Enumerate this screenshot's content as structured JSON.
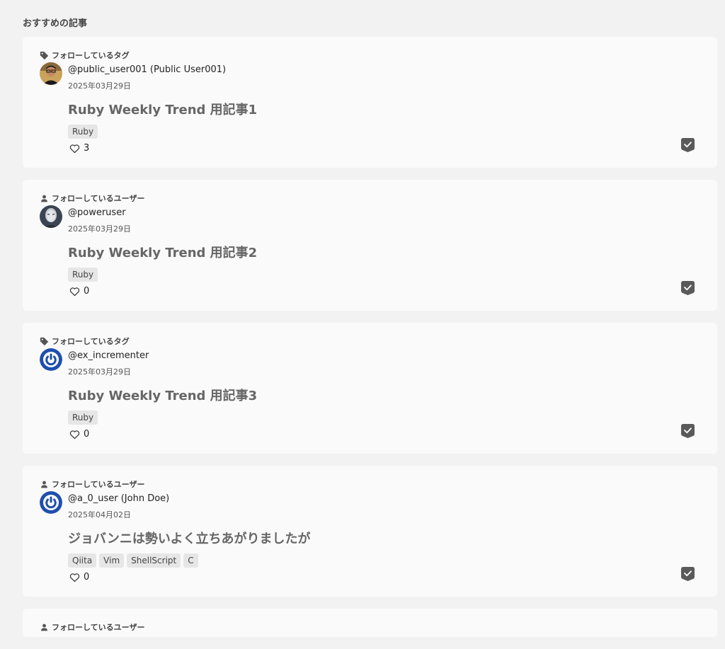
{
  "page": {
    "section_title": "おすすめの記事"
  },
  "articles": [
    {
      "reason": "フォローしているタグ",
      "reason_icon": "tag-icon",
      "author": "@public_user001 (Public User001)",
      "avatar": "avatar-photo-man",
      "date": "2025年03月29日",
      "title": "Ruby Weekly Trend 用記事1",
      "tags": [
        "Ruby"
      ],
      "likes": "3"
    },
    {
      "reason": "フォローしているユーザー",
      "reason_icon": "user-icon",
      "author": "@poweruser",
      "avatar": "avatar-photo-face",
      "date": "2025年03月29日",
      "title": "Ruby Weekly Trend 用記事2",
      "tags": [
        "Ruby"
      ],
      "likes": "0"
    },
    {
      "reason": "フォローしているタグ",
      "reason_icon": "tag-icon",
      "author": "@ex_incrementer",
      "avatar": "avatar-power-logo",
      "date": "2025年03月29日",
      "title": "Ruby Weekly Trend 用記事3",
      "tags": [
        "Ruby"
      ],
      "likes": "0"
    },
    {
      "reason": "フォローしているユーザー",
      "reason_icon": "user-icon",
      "author": "@a_0_user (John Doe)",
      "avatar": "avatar-power-logo",
      "date": "2025年04月02日",
      "title": "ジョバンニは勢いよく立ちあがりましたが",
      "tags": [
        "Qiita",
        "Vim",
        "ShellScript",
        "C"
      ],
      "likes": "0"
    }
  ],
  "partial_article": {
    "reason": "フォローしているユーザー",
    "reason_icon": "user-icon"
  },
  "colors": {
    "background": "#f2f2f2",
    "card": "#fafafa",
    "stock_button": "#5a5a5a",
    "power_logo": "#1e4fae"
  }
}
